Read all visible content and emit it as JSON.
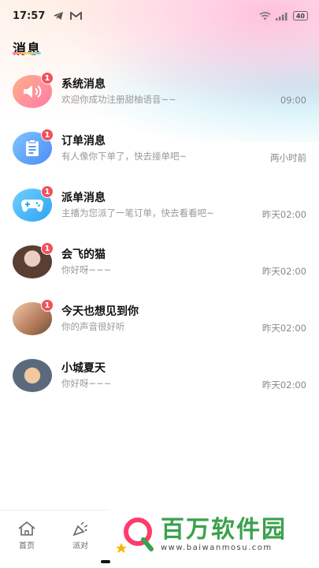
{
  "status_bar": {
    "time": "17:57",
    "battery": "40"
  },
  "page": {
    "title": "消息"
  },
  "messages": [
    {
      "name": "系统消息",
      "preview": "欢迎你成功注册甜柚语音~~",
      "time": "09:00",
      "badge": "1",
      "icon": "speaker-icon"
    },
    {
      "name": "订单消息",
      "preview": "有人像你下单了，快去接单吧~",
      "time": "两小时前",
      "badge": "1",
      "icon": "clipboard-icon"
    },
    {
      "name": "派单消息",
      "preview": "主播为您派了一笔订单，快去看看吧~",
      "time": "昨天02:00",
      "badge": "1",
      "icon": "gamepad-icon"
    },
    {
      "name": "会飞的猫",
      "preview": "你好呀~~~",
      "time": "昨天02:00",
      "badge": "1",
      "icon": "user-avatar"
    },
    {
      "name": "今天也想见到你",
      "preview": "你的声音很好听",
      "time": "昨天02:00",
      "badge": "1",
      "icon": "user-avatar"
    },
    {
      "name": "小城夏天",
      "preview": "你好呀~~~",
      "time": "昨天02:00",
      "badge": "",
      "icon": "user-avatar"
    }
  ],
  "bottom_nav": {
    "items": [
      {
        "label": "首页",
        "icon": "home-icon"
      },
      {
        "label": "派对",
        "icon": "party-icon"
      }
    ]
  },
  "watermark": {
    "main": "百万软件园",
    "sub": "www.baiwanmosu.com"
  },
  "colors": {
    "badge": "#f0525a",
    "watermark_green": "#3aa14c"
  }
}
